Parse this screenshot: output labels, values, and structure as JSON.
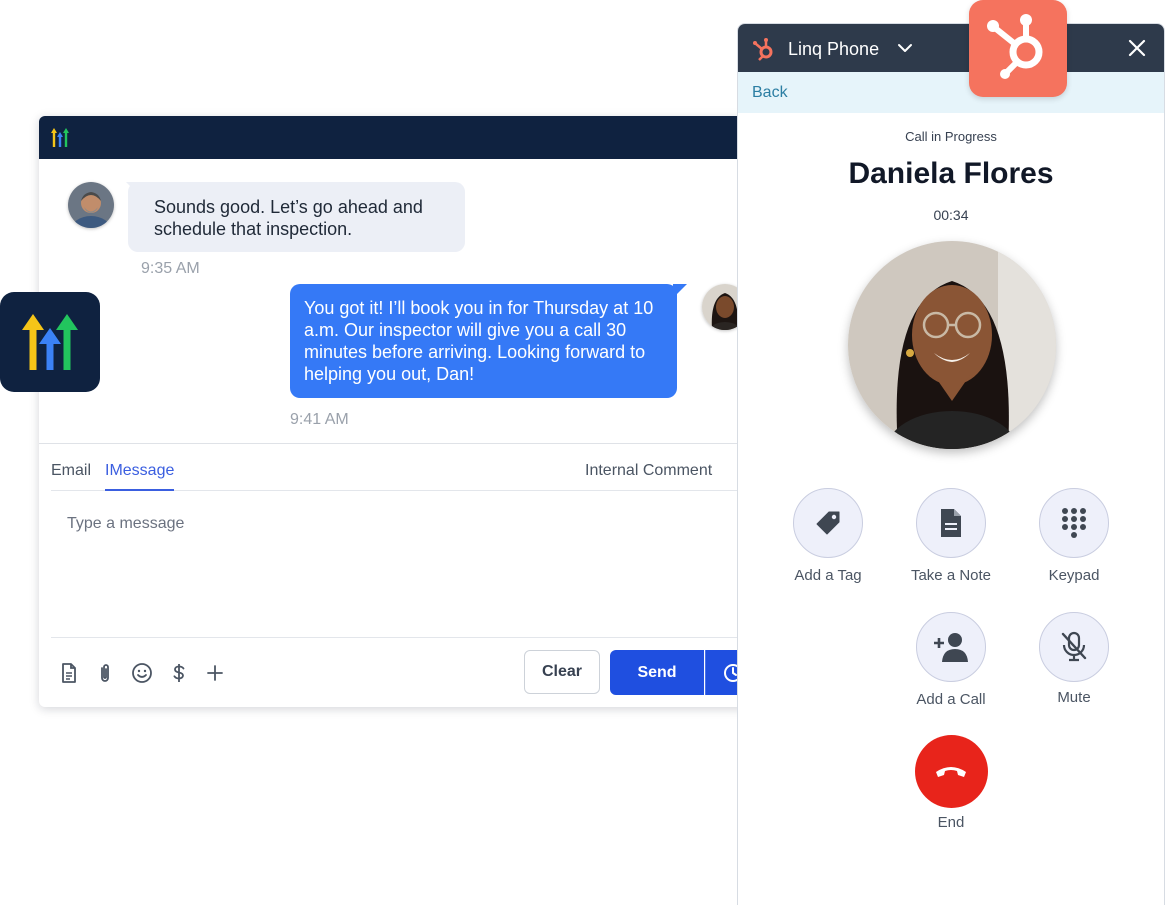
{
  "chat": {
    "incoming_message": "Sounds good. Let’s go ahead and schedule that inspection.",
    "incoming_time": "9:35 AM",
    "outgoing_message": "You got it! I’ll book you in for Thursday at 10 a.m. Our inspector will give you a call 30 minutes before arriving. Looking forward to helping you out, Dan!",
    "outgoing_time": "9:41 AM"
  },
  "composer": {
    "tabs": [
      "Email",
      "IMessage",
      "Internal Comment"
    ],
    "active_tab": "IMessage",
    "placeholder": "Type a message",
    "clear_label": "Clear",
    "send_label": "Send",
    "tools": [
      "document-icon",
      "paperclip-icon",
      "emoji-icon",
      "dollar-icon",
      "plus-icon"
    ]
  },
  "phone": {
    "app_name": "Linq Phone",
    "back_label": "Back",
    "status": "Call in Progress",
    "caller_name": "Daniela Flores",
    "timer": "00:34",
    "actions": {
      "add_tag": "Add a Tag",
      "take_note": "Take a Note",
      "keypad": "Keypad",
      "add_call": "Add a Call",
      "mute": "Mute",
      "end": "End"
    }
  },
  "colors": {
    "navy": "#0f2240",
    "bubble_blue": "#3579f6",
    "send_blue": "#1f4fe0",
    "phone_header": "#2e3a4b",
    "back_bar": "#e6f4fa",
    "end_red": "#e8241b",
    "hubspot_orange": "#f5735e",
    "arrow_yellow": "#f5c518",
    "arrow_blue": "#3b82f6",
    "arrow_green": "#22c55e"
  }
}
